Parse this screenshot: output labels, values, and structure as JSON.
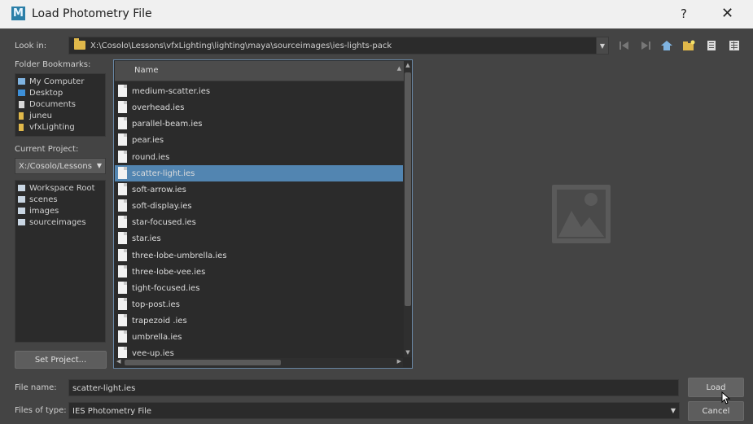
{
  "window": {
    "title": "Load Photometry File",
    "app_icon_letter": "M",
    "help": "?",
    "close": "✕"
  },
  "look_in": {
    "label": "Look in:",
    "path": "X:\\Cosolo\\Lessons\\vfxLighting\\lighting\\maya\\sourceimages\\ies-lights-pack"
  },
  "toolbar": {
    "icons": [
      "back-icon",
      "forward-icon",
      "home-icon",
      "new-folder-icon",
      "list-view-icon",
      "detail-view-icon"
    ]
  },
  "bookmarks": {
    "label": "Folder Bookmarks:",
    "items": [
      {
        "label": "My Computer",
        "icon": "computer-icon",
        "color": "#7fb3e0"
      },
      {
        "label": "Desktop",
        "icon": "desktop-icon",
        "color": "#3d8fd8"
      },
      {
        "label": "Documents",
        "icon": "documents-icon",
        "color": "#d8d8d8"
      },
      {
        "label": "juneu",
        "icon": "folder-user-icon",
        "color": "#e0b84a"
      },
      {
        "label": "vfxLighting",
        "icon": "folder-user-icon",
        "color": "#e0b84a"
      }
    ]
  },
  "current_project": {
    "label": "Current Project:",
    "value": "X:/Cosolo/Lessons/",
    "items": [
      {
        "label": "Workspace Root",
        "icon": "folder-icon"
      },
      {
        "label": "scenes",
        "icon": "folder-icon"
      },
      {
        "label": "images",
        "icon": "folder-icon"
      },
      {
        "label": "sourceimages",
        "icon": "folder-icon"
      }
    ],
    "set_project_label": "Set Project..."
  },
  "file_list": {
    "column_header": "Name",
    "selected_index": 5,
    "files": [
      "medium-scatter.ies",
      "overhead.ies",
      "parallel-beam.ies",
      "pear.ies",
      "round.ies",
      "scatter-light.ies",
      "soft-arrow.ies",
      "soft-display.ies",
      "star-focused.ies",
      "star.ies",
      "three-lobe-umbrella.ies",
      "three-lobe-vee.ies",
      "tight-focused.ies",
      "top-post.ies",
      "trapezoid .ies",
      "umbrella.ies",
      "vee-up.ies"
    ]
  },
  "file_name": {
    "label": "File name:",
    "value": "scatter-light.ies"
  },
  "files_of_type": {
    "label": "Files of type:",
    "value": "IES Photometry File"
  },
  "buttons": {
    "load": "Load",
    "cancel": "Cancel"
  },
  "colors": {
    "selection": "#5285b1",
    "panel": "#2b2b2b",
    "background": "#444444"
  }
}
